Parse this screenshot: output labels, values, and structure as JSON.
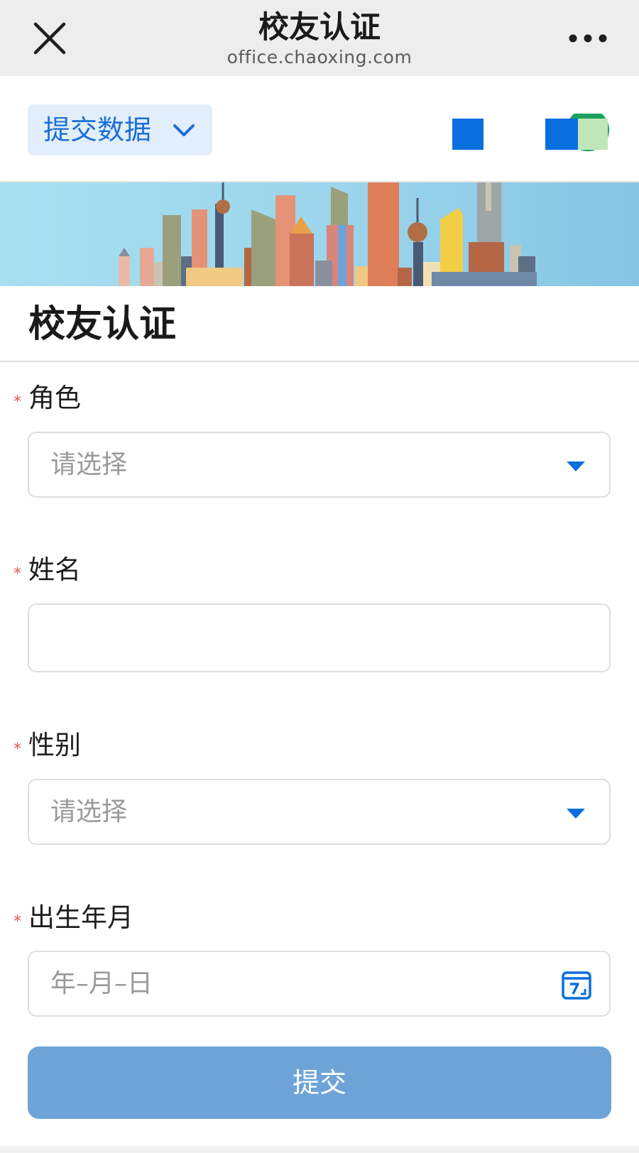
{
  "navbar": {
    "title": "校友认证",
    "domain": "office.chaoxing.com",
    "close_icon": "close-icon",
    "more_icon": "more-dots-icon"
  },
  "toolbar": {
    "submit_data_label": "提交数据",
    "chevron_icon": "chevron-down-icon"
  },
  "form": {
    "title": "校友认证",
    "required_mark": "*",
    "fields": [
      {
        "label": "角色",
        "type": "select",
        "placeholder": "请选择",
        "value": ""
      },
      {
        "label": "姓名",
        "type": "text",
        "placeholder": "",
        "value": ""
      },
      {
        "label": "性别",
        "type": "select",
        "placeholder": "请选择",
        "value": ""
      },
      {
        "label": "出生年月",
        "type": "date",
        "placeholder": "年–月–日",
        "value": ""
      }
    ],
    "submit_label": "提交"
  },
  "colors": {
    "accent": "#1a6fd6",
    "submit_button": "#6ea3d8",
    "required_star": "#e0574f",
    "navbar_bg": "#ededed"
  }
}
